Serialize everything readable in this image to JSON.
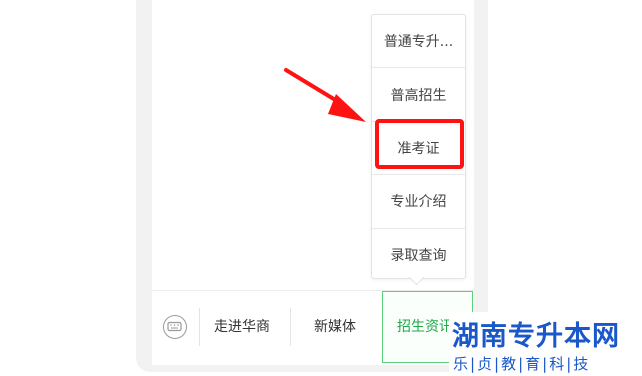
{
  "menu": {
    "items": [
      {
        "label": "普通专升..."
      },
      {
        "label": "普高招生"
      },
      {
        "label": "准考证"
      },
      {
        "label": "专业介绍"
      },
      {
        "label": "录取查询"
      }
    ]
  },
  "bottom_bar": {
    "tabs": [
      {
        "label": "走进华商"
      },
      {
        "label": "新媒体"
      },
      {
        "label": "招生资讯"
      }
    ]
  },
  "watermark": {
    "title": "湖南专升本网",
    "subtitle": "乐|贞|教|育|科|技"
  },
  "colors": {
    "highlight": "#ff1212",
    "active_tab": "#1fa84a",
    "watermark": "#1a57c8"
  }
}
